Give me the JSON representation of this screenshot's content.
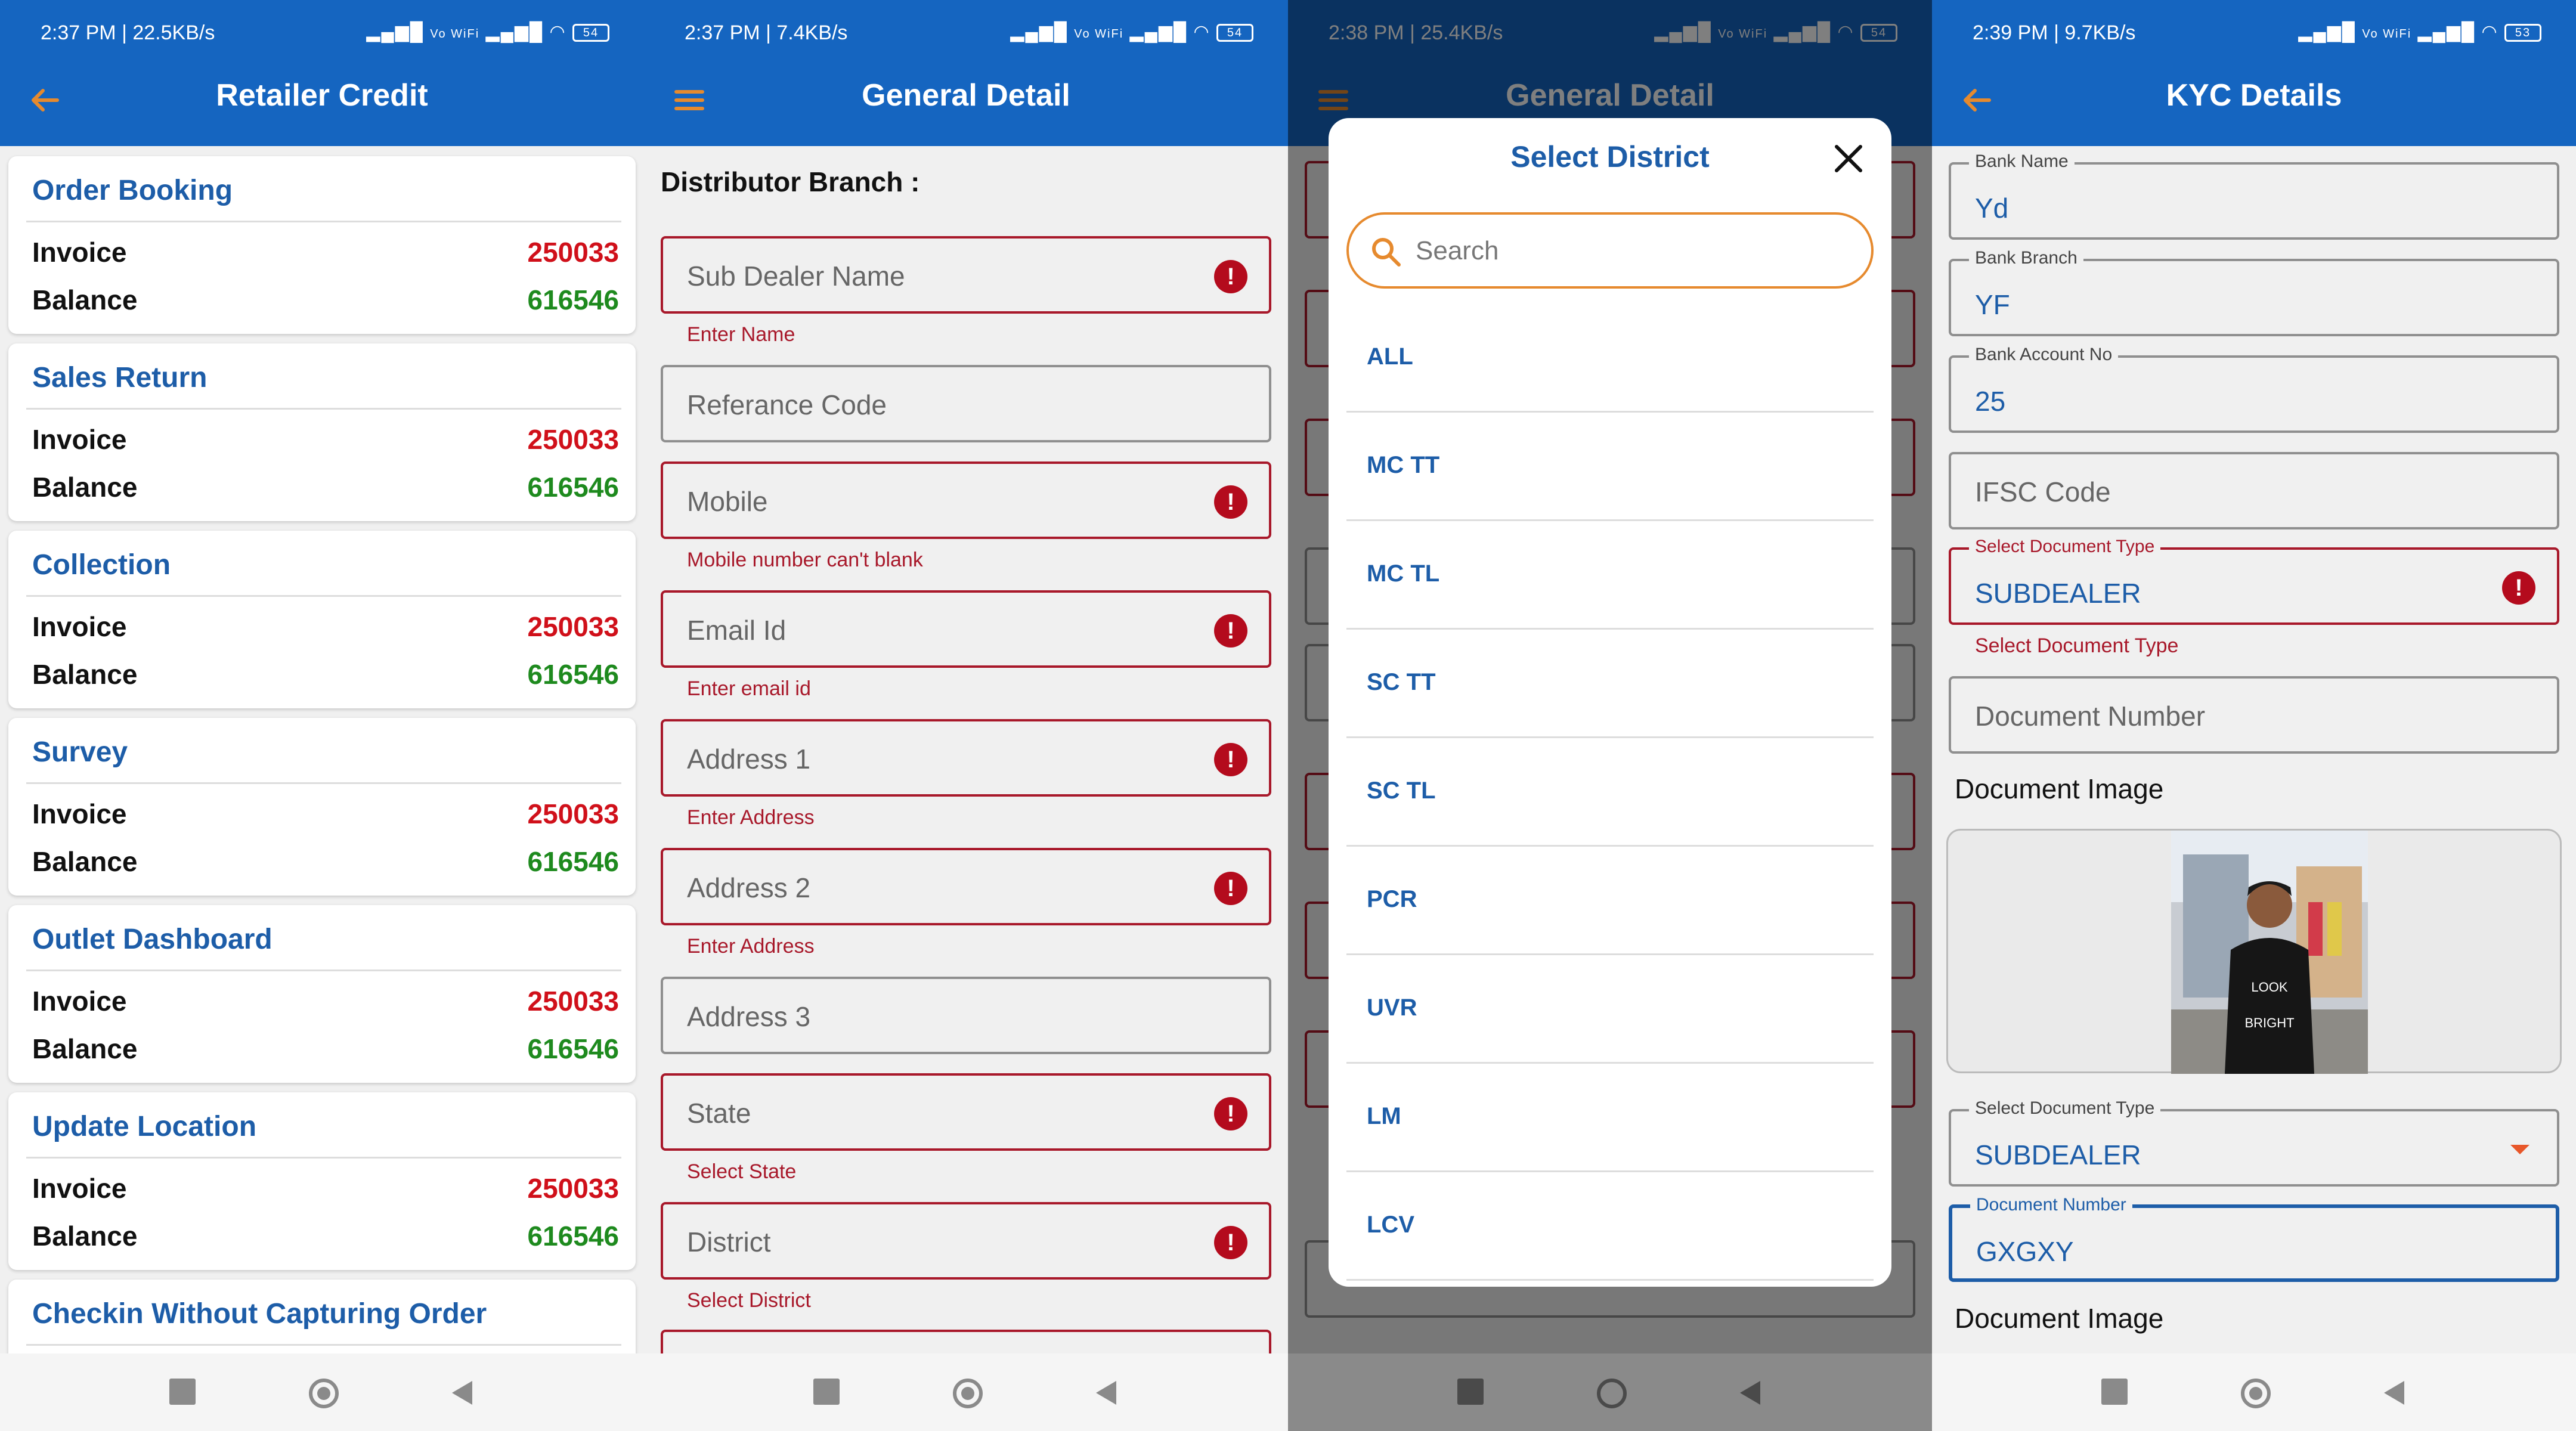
{
  "colors": {
    "primary": "#1565c0",
    "accent_orange": "#e68a2e",
    "title_blue": "#1d5da8",
    "error_red": "#a8182a",
    "invoice_red": "#d0101a",
    "balance_green": "#1e8a1e"
  },
  "panel1": {
    "status": {
      "time": "2:37 PM | 22.5KB/s",
      "signal": "Vo WiFi",
      "battery": "54"
    },
    "title": "Retailer Credit",
    "back_icon": "back-arrow-icon",
    "cards": [
      {
        "title": "Order Booking",
        "invoice_label": "Invoice",
        "invoice": "250033",
        "balance_label": "Balance",
        "balance": "616546"
      },
      {
        "title": "Sales Return",
        "invoice_label": "Invoice",
        "invoice": "250033",
        "balance_label": "Balance",
        "balance": "616546"
      },
      {
        "title": "Collection",
        "invoice_label": "Invoice",
        "invoice": "250033",
        "balance_label": "Balance",
        "balance": "616546"
      },
      {
        "title": "Survey",
        "invoice_label": "Invoice",
        "invoice": "250033",
        "balance_label": "Balance",
        "balance": "616546"
      },
      {
        "title": "Outlet Dashboard",
        "invoice_label": "Invoice",
        "invoice": "250033",
        "balance_label": "Balance",
        "balance": "616546"
      },
      {
        "title": "Update Location",
        "invoice_label": "Invoice",
        "invoice": "250033",
        "balance_label": "Balance",
        "balance": "616546"
      },
      {
        "title": "Checkin Without Capturing Order"
      }
    ]
  },
  "panel2": {
    "status": {
      "time": "2:37 PM | 7.4KB/s",
      "signal": "Vo WiFi",
      "battery": "54"
    },
    "title": "General Detail",
    "menu_icon": "hamburger-menu-icon",
    "section": "Distributor Branch :",
    "fields": [
      {
        "placeholder": "Sub Dealer Name",
        "error": "Enter Name"
      },
      {
        "placeholder": "Referance Code"
      },
      {
        "placeholder": "Mobile",
        "error": "Mobile number can't blank"
      },
      {
        "placeholder": "Email Id",
        "error": "Enter email id"
      },
      {
        "placeholder": "Address 1",
        "error": "Enter Address"
      },
      {
        "placeholder": "Address 2",
        "error": "Enter Address"
      },
      {
        "placeholder": "Address 3"
      },
      {
        "placeholder": "State",
        "error": "Select State"
      },
      {
        "placeholder": "District",
        "error": "Select District"
      }
    ]
  },
  "panel3": {
    "status": {
      "time": "2:38 PM | 25.4KB/s",
      "signal": "Vo WiFi",
      "battery": "54"
    },
    "title": "General Detail",
    "dialog": {
      "title": "Select District",
      "close_icon": "close-icon",
      "search_placeholder": "Search",
      "items": [
        "ALL",
        "MC TT",
        "MC TL",
        "SC TT",
        "SC TL",
        "PCR",
        "UVR",
        "LM",
        "LCV"
      ]
    }
  },
  "panel4": {
    "status": {
      "time": "2:39 PM | 9.7KB/s",
      "signal": "Vo WiFi",
      "battery": "53"
    },
    "title": "KYC Details",
    "back_icon": "back-arrow-icon",
    "bank_name": {
      "label": "Bank Name",
      "value": "Yd"
    },
    "bank_branch": {
      "label": "Bank Branch",
      "value": "YF"
    },
    "bank_account": {
      "label": "Bank Account No",
      "value": "25"
    },
    "ifsc": {
      "placeholder": "IFSC Code"
    },
    "doc_type_1": {
      "label": "Select Document Type",
      "value": "SUBDEALER",
      "error": "Select Document Type"
    },
    "doc_number_1": {
      "placeholder": "Document Number"
    },
    "doc_image_label": "Document Image",
    "doc_type_2": {
      "label": "Select Document Type",
      "value": "SUBDEALER"
    },
    "doc_number_2": {
      "label": "Document Number",
      "value": "GXGXY"
    },
    "doc_image_label_2": "Document Image"
  }
}
